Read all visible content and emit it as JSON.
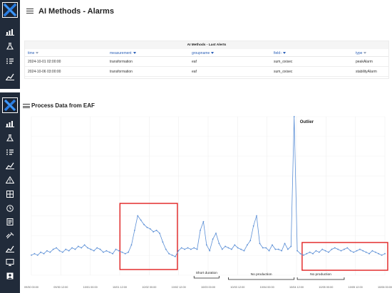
{
  "top": {
    "title": "AI Methods - Alarms",
    "panel_title": "AI Methods - Last Alerts",
    "columns": [
      "time",
      "measurement",
      "groupname",
      "field",
      "type"
    ],
    "rows": [
      [
        "2024-10-01 02:00:00",
        "transformation",
        "eaf",
        "sum_oxisec",
        "peakAlarm"
      ],
      [
        "2024-10-06 03:00:00",
        "transformation",
        "eaf",
        "sum_oxisec",
        "stabilityAlarm"
      ]
    ]
  },
  "bottom": {
    "title": "Process Data from EAF"
  },
  "colors": {
    "sidebar": "#212b3a",
    "line": "#5b8fd6",
    "highlight_box": "#e02020"
  },
  "icons": [
    "dashboard-icon",
    "flask-icon",
    "list-icon",
    "trend-icon",
    "warning-icon",
    "grid-icon",
    "report-icon",
    "monitor-icon",
    "user-icon"
  ],
  "annotations": {
    "outlier": "Outlier",
    "short_duration": "Short duration",
    "no_production_1": "No production",
    "no_production_2": "No production"
  },
  "chart_data": {
    "type": "line",
    "x_ticks": [
      "09/30 00:00",
      "09/30 12:00",
      "10/01 00:00",
      "10/01 12:00",
      "10/02 00:00",
      "10/02 12:00",
      "10/03 00:00",
      "10/03 12:00",
      "10/04 00:00",
      "10/04 12:00",
      "10/05 00:00",
      "10/05 12:00",
      "10/06 00:00"
    ],
    "series": [
      {
        "values": [
          0.05,
          0.06,
          0.05,
          0.07,
          0.06,
          0.08,
          0.07,
          0.09,
          0.1,
          0.08,
          0.07,
          0.09,
          0.08,
          0.1,
          0.09,
          0.11,
          0.1,
          0.12,
          0.1,
          0.09,
          0.08,
          0.1,
          0.09,
          0.07,
          0.08,
          0.07,
          0.06,
          0.09,
          0.08,
          0.07,
          0.06,
          0.07,
          0.12,
          0.22,
          0.32,
          0.29,
          0.26,
          0.24,
          0.23,
          0.21,
          0.22,
          0.2,
          0.14,
          0.09,
          0.06,
          0.05,
          0.04,
          0.08,
          0.1,
          0.09,
          0.1,
          0.09,
          0.1,
          0.09,
          0.22,
          0.28,
          0.12,
          0.08,
          0.16,
          0.2,
          0.13,
          0.09,
          0.11,
          0.1,
          0.09,
          0.12,
          0.1,
          0.09,
          0.08,
          0.12,
          0.15,
          0.25,
          0.32,
          0.13,
          0.1,
          0.1,
          0.08,
          0.12,
          0.09,
          0.09,
          0.08,
          0.13,
          0.09,
          0.11,
          1.0,
          0.08,
          0.06,
          0.05,
          0.06,
          0.07,
          0.06,
          0.08,
          0.07,
          0.09,
          0.08,
          0.07,
          0.09,
          0.1,
          0.09,
          0.08,
          0.09,
          0.1,
          0.08,
          0.07,
          0.08,
          0.09,
          0.08,
          0.07,
          0.06,
          0.08,
          0.07,
          0.06,
          0.05,
          0.06
        ]
      }
    ]
  }
}
